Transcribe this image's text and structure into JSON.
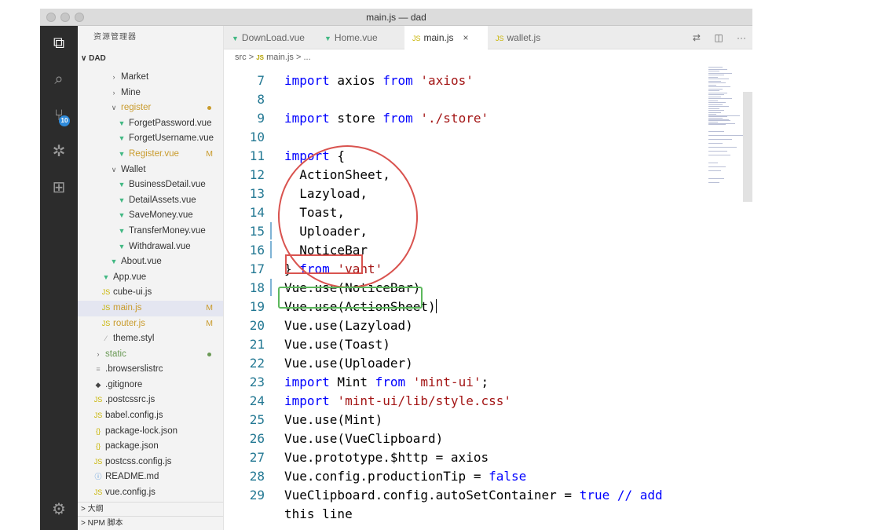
{
  "window": {
    "title": "main.js — dad"
  },
  "activity_bar": {
    "items": [
      {
        "name": "explorer",
        "glyph": "⧉"
      },
      {
        "name": "search",
        "glyph": "⌕"
      },
      {
        "name": "source-control",
        "glyph": "⑂",
        "badge": "10"
      },
      {
        "name": "debug",
        "glyph": "✲"
      },
      {
        "name": "extensions",
        "glyph": "⊞"
      }
    ],
    "manage_glyph": "⚙"
  },
  "sidebar": {
    "header": "资源管理器",
    "section": "∨ DAD",
    "items": [
      {
        "indent": 2,
        "ic": "›",
        "label": "Market",
        "color": "#333333"
      },
      {
        "indent": 2,
        "ic": "›",
        "label": "Mine",
        "color": "#333333"
      },
      {
        "indent": 2,
        "ic": "∨",
        "label": "register",
        "color": "#c99b2c",
        "dot": "#c99b2c"
      },
      {
        "indent": 3,
        "ic": "▼",
        "icolor": "#42b883",
        "label": "ForgetPassword.vue",
        "color": "#333333"
      },
      {
        "indent": 3,
        "ic": "▼",
        "icolor": "#42b883",
        "label": "ForgetUsername.vue",
        "color": "#333333"
      },
      {
        "indent": 3,
        "ic": "▼",
        "icolor": "#42b883",
        "label": "Register.vue",
        "color": "#c99b2c",
        "status": "M"
      },
      {
        "indent": 2,
        "ic": "∨",
        "label": "Wallet",
        "color": "#333333"
      },
      {
        "indent": 3,
        "ic": "▼",
        "icolor": "#42b883",
        "label": "BusinessDetail.vue",
        "color": "#333333"
      },
      {
        "indent": 3,
        "ic": "▼",
        "icolor": "#42b883",
        "label": "DetailAssets.vue",
        "color": "#333333"
      },
      {
        "indent": 3,
        "ic": "▼",
        "icolor": "#42b883",
        "label": "SaveMoney.vue",
        "color": "#333333"
      },
      {
        "indent": 3,
        "ic": "▼",
        "icolor": "#42b883",
        "label": "TransferMoney.vue",
        "color": "#333333"
      },
      {
        "indent": 3,
        "ic": "▼",
        "icolor": "#42b883",
        "label": "Withdrawal.vue",
        "color": "#333333"
      },
      {
        "indent": 2,
        "ic": "▼",
        "icolor": "#42b883",
        "label": "About.vue",
        "color": "#333333"
      },
      {
        "indent": 1,
        "ic": "▼",
        "icolor": "#42b883",
        "label": "App.vue",
        "color": "#333333"
      },
      {
        "indent": 1,
        "ic": "JS",
        "icolor": "#c8b400",
        "label": "cube-ui.js",
        "color": "#333333"
      },
      {
        "indent": 1,
        "ic": "JS",
        "icolor": "#c8b400",
        "label": "main.js",
        "color": "#c99b2c",
        "status": "M",
        "selected": true
      },
      {
        "indent": 1,
        "ic": "JS",
        "icolor": "#c8b400",
        "label": "router.js",
        "color": "#c99b2c",
        "status": "M"
      },
      {
        "indent": 1,
        "ic": "⁄",
        "icolor": "#9c9c9c",
        "label": "theme.styl",
        "color": "#333333"
      },
      {
        "indent": 0,
        "ic": "›",
        "label": "static",
        "color": "#6a9955",
        "dot": "#6a9955"
      },
      {
        "indent": 0,
        "ic": "≡",
        "icolor": "#9c9c9c",
        "label": ".browserslistrc",
        "color": "#333333"
      },
      {
        "indent": 0,
        "ic": "◆",
        "icolor": "#444444",
        "label": ".gitignore",
        "color": "#333333"
      },
      {
        "indent": 0,
        "ic": "JS",
        "icolor": "#c8b400",
        "label": ".postcssrc.js",
        "color": "#333333"
      },
      {
        "indent": 0,
        "ic": "JS",
        "icolor": "#c8b400",
        "label": "babel.config.js",
        "color": "#333333"
      },
      {
        "indent": 0,
        "ic": "{}",
        "icolor": "#c8b400",
        "label": "package-lock.json",
        "color": "#333333"
      },
      {
        "indent": 0,
        "ic": "{}",
        "icolor": "#c8b400",
        "label": "package.json",
        "color": "#333333"
      },
      {
        "indent": 0,
        "ic": "JS",
        "icolor": "#c8b400",
        "label": "postcss.config.js",
        "color": "#333333"
      },
      {
        "indent": 0,
        "ic": "ⓘ",
        "icolor": "#4a8fd7",
        "label": "README.md",
        "color": "#333333"
      },
      {
        "indent": 0,
        "ic": "JS",
        "icolor": "#c8b400",
        "label": "vue.config.js",
        "color": "#333333"
      }
    ],
    "footer": [
      "> 大纲",
      "> NPM 脚本"
    ]
  },
  "tabs": [
    {
      "label": "DownLoad.vue",
      "ic": "▼",
      "icolor": "#42b883"
    },
    {
      "label": "Home.vue",
      "ic": "▼",
      "icolor": "#42b883"
    },
    {
      "label": "main.js",
      "ic": "JS",
      "icolor": "#c8b400",
      "active": true,
      "close": "×"
    },
    {
      "label": "wallet.js",
      "ic": "JS",
      "icolor": "#c8b400"
    }
  ],
  "tab_actions": [
    "⇄",
    "◫",
    "···"
  ],
  "breadcrumb": {
    "path_start": "src >",
    "js": "JS",
    "path_end": "main.js > ..."
  },
  "code": [
    {
      "n": "7",
      "tokens": [
        [
          "kw",
          "import"
        ],
        [
          "t",
          " axios "
        ],
        [
          "kw",
          "from"
        ],
        [
          "t",
          " "
        ],
        [
          "str",
          "'axios'"
        ]
      ]
    },
    {
      "n": "8",
      "tokens": []
    },
    {
      "n": "9",
      "tokens": [
        [
          "kw",
          "import"
        ],
        [
          "t",
          " store "
        ],
        [
          "kw",
          "from"
        ],
        [
          "t",
          " "
        ],
        [
          "str",
          "'./store'"
        ]
      ]
    },
    {
      "n": "10",
      "tokens": []
    },
    {
      "n": "11",
      "tokens": [
        [
          "kw",
          "import"
        ],
        [
          "t",
          " {"
        ]
      ]
    },
    {
      "n": "12",
      "tokens": [
        [
          "t",
          "  ActionSheet,"
        ]
      ]
    },
    {
      "n": "13",
      "tokens": [
        [
          "t",
          "  Lazyload,"
        ]
      ]
    },
    {
      "n": "14",
      "tokens": [
        [
          "t",
          "  Toast,"
        ]
      ]
    },
    {
      "n": "15",
      "tokens": [
        [
          "t",
          "  Uploader,"
        ]
      ],
      "mark": true
    },
    {
      "n": "16",
      "tokens": [
        [
          "t",
          "  NoticeBar"
        ]
      ],
      "mark": true
    },
    {
      "n": "17",
      "tokens": [
        [
          "t",
          "} "
        ],
        [
          "kw",
          "from"
        ],
        [
          "t",
          " "
        ],
        [
          "str",
          "'vant'"
        ]
      ]
    },
    {
      "n": "18",
      "tokens": [
        [
          "t",
          "Vue.use(NoticeBar)"
        ]
      ],
      "mark": true
    },
    {
      "n": "19",
      "tokens": [
        [
          "t",
          "Vue.use(ActionSheet)"
        ]
      ],
      "cursor": true
    },
    {
      "n": "20",
      "tokens": [
        [
          "t",
          "Vue.use(Lazyload)"
        ]
      ]
    },
    {
      "n": "21",
      "tokens": [
        [
          "t",
          "Vue.use(Toast)"
        ]
      ]
    },
    {
      "n": "22",
      "tokens": [
        [
          "t",
          "Vue.use(Uploader)"
        ]
      ]
    },
    {
      "n": "23",
      "tokens": [
        [
          "kw",
          "import"
        ],
        [
          "t",
          " Mint "
        ],
        [
          "kw",
          "from"
        ],
        [
          "t",
          " "
        ],
        [
          "str",
          "'mint-ui'"
        ],
        [
          "t",
          ";"
        ]
      ]
    },
    {
      "n": "24",
      "tokens": [
        [
          "kw",
          "import"
        ],
        [
          "t",
          " "
        ],
        [
          "str",
          "'mint-ui/lib/style.css'"
        ]
      ]
    },
    {
      "n": "25",
      "tokens": [
        [
          "t",
          "Vue.use(Mint)"
        ]
      ]
    },
    {
      "n": "26",
      "tokens": [
        [
          "t",
          "Vue.use(VueClipboard)"
        ]
      ]
    },
    {
      "n": "27",
      "tokens": [
        [
          "t",
          "Vue.prototype.$http = axios"
        ]
      ]
    },
    {
      "n": "28",
      "tokens": [
        [
          "t",
          "Vue.config.productionTip = "
        ],
        [
          "kw",
          "false"
        ]
      ]
    },
    {
      "n": "29",
      "tokens": [
        [
          "t",
          "VueClipboard.config.autoSetContainer = "
        ],
        [
          "kw",
          "true"
        ],
        [
          "t",
          " "
        ],
        [
          "kw",
          "// add"
        ]
      ]
    },
    {
      "n": "",
      "tokens": [
        [
          "t",
          "this line"
        ]
      ]
    }
  ],
  "colors": {
    "keyword": "#0000ff",
    "string": "#a31515",
    "line_number": "#237893",
    "annotation_red": "#d9534f",
    "annotation_green": "#5cb85c"
  }
}
